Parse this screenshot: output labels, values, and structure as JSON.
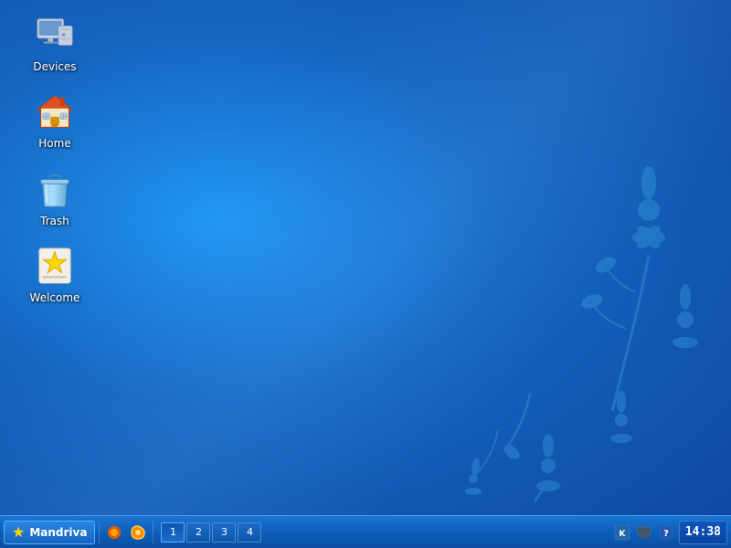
{
  "desktop": {
    "icons": [
      {
        "id": "devices",
        "label": "Devices",
        "type": "computer"
      },
      {
        "id": "home",
        "label": "Home",
        "type": "home"
      },
      {
        "id": "trash",
        "label": "Trash",
        "type": "trash"
      },
      {
        "id": "welcome",
        "label": "Welcome",
        "type": "star"
      }
    ]
  },
  "taskbar": {
    "start_label": "Mandriva",
    "workspaces": [
      "1",
      "2",
      "3",
      "4"
    ],
    "active_workspace": 0,
    "clock": "14:38"
  }
}
